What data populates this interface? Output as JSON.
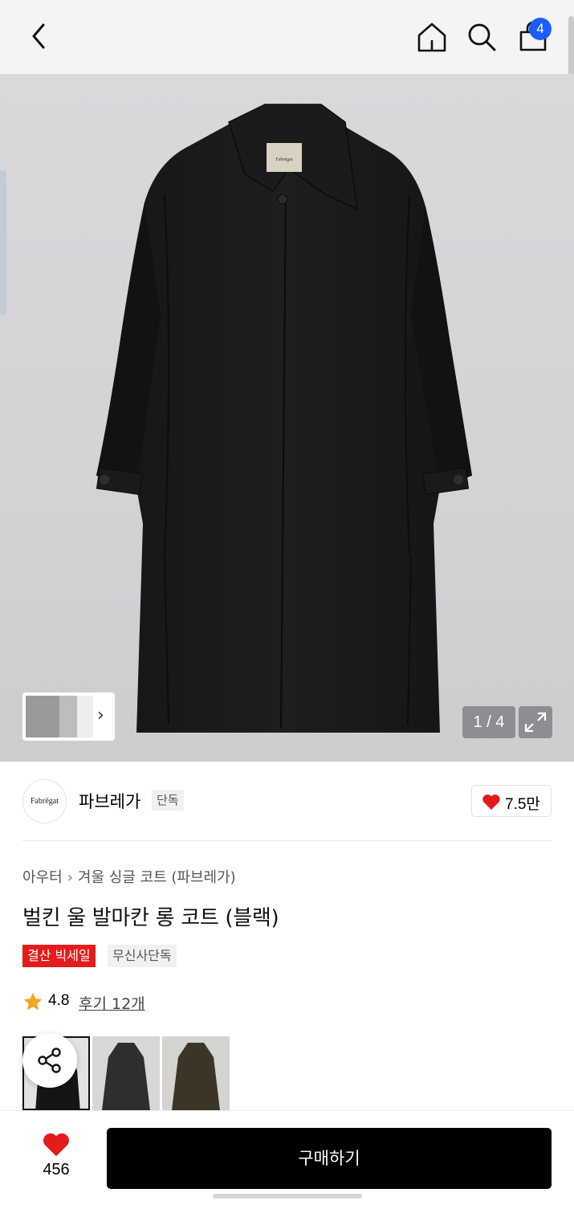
{
  "header": {
    "back_icon": "chevron-left-icon",
    "home_icon": "home-icon",
    "search_icon": "search-icon",
    "cart_icon": "shopping-bag-icon",
    "cart_count": "4",
    "badge_color": "#1a5cff"
  },
  "gallery": {
    "counter": "1 / 4",
    "expand_icon": "expand-icon",
    "thumbnails_next_icon": "chevron-right-icon"
  },
  "brand": {
    "logo_text": "Fabrēgat",
    "name": "파브레가",
    "tag": "단독",
    "like_count": "7.5만",
    "like_color": "#e31b1b"
  },
  "product": {
    "breadcrumb": [
      "아우터",
      "겨울 싱글 코트 (파브레가)"
    ],
    "title": "벌킨 울 발마칸 롱 코트 (블랙)",
    "badges": {
      "sale": "결산 빅세일",
      "exclusive": "무신사단독"
    },
    "sale_color": "#e31b1b",
    "rating": "4.8",
    "reviews": "후기 12개",
    "star_color": "#f5a623"
  },
  "bottom_bar": {
    "wish_count": "456",
    "buy_label": "구매하기"
  }
}
